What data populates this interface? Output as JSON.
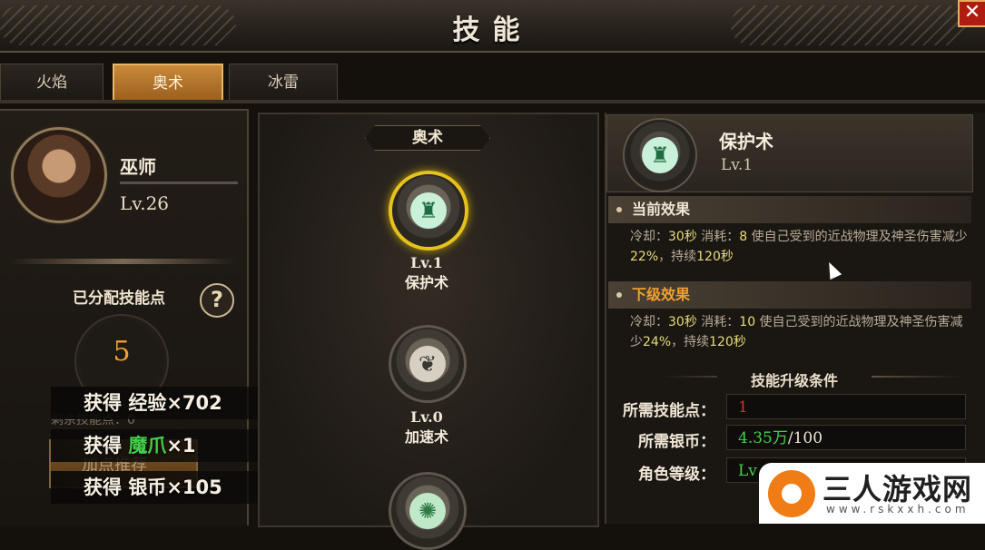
{
  "window": {
    "title": "技能",
    "close_label": "✕"
  },
  "tabs": [
    {
      "label": "火焰",
      "active": false
    },
    {
      "label": "奥术",
      "active": true
    },
    {
      "label": "冰雷",
      "active": false
    }
  ],
  "hero": {
    "name": "巫师",
    "level": "Lv.26"
  },
  "points": {
    "allocated_label": "已分配技能点",
    "help_icon": "?",
    "allocated_value": "5",
    "remaining_label": "剩余技能点：0",
    "recommend_label": "加点推荐"
  },
  "rewards": [
    {
      "prefix": "获得 ",
      "item": "经验",
      "suffix": "×702",
      "highlight": false
    },
    {
      "prefix": "获得 ",
      "item": "魔爪",
      "suffix": "×1",
      "highlight": true
    },
    {
      "prefix": "获得 ",
      "item": "银币",
      "suffix": "×105",
      "highlight": false
    }
  ],
  "school": {
    "label": "奥术"
  },
  "skills": [
    {
      "name": "保护术",
      "level": "Lv.1",
      "icon": "shield-rune-icon",
      "glyph": "♜",
      "selected": true
    },
    {
      "name": "加速术",
      "level": "Lv.0",
      "icon": "wing-boot-icon",
      "glyph": "❦",
      "selected": false
    },
    {
      "name": "",
      "level": "",
      "icon": "orb-icon",
      "glyph": "✺",
      "selected": false
    }
  ],
  "detail": {
    "name": "保护术",
    "level": "Lv.1",
    "icon": "shield-rune-icon",
    "current_title": "当前效果",
    "current": {
      "p1": "冷却：",
      "cd": "30秒",
      "p2": " 消耗：",
      "cost": "8",
      "p3": " 使自己受到的近战物理及神圣伤害减少",
      "pct": "22%",
      "p4": "，持续",
      "dur": "120秒"
    },
    "next_title": "下级效果",
    "next": {
      "p1": "冷却：",
      "cd": "30秒",
      "p2": " 消耗：",
      "cost": "10",
      "p3": " 使自己受到的近战物理及神圣伤害减少",
      "pct": "24%",
      "p4": "，持续",
      "dur": "120秒"
    }
  },
  "conditions": {
    "title": "技能升级条件",
    "rows": [
      {
        "label": "所需技能点：",
        "value": "1",
        "extra": "",
        "color": "#d83030"
      },
      {
        "label": "所需银币：",
        "value": "4.35万",
        "extra": "/100",
        "color": "#44d04a"
      },
      {
        "label": "角色等级：",
        "value": "Lv",
        "extra": "",
        "color": "#44d04a"
      }
    ]
  },
  "watermark": {
    "text": "三人游戏网",
    "url": "www.rskxxh.com"
  },
  "colors": {
    "accent": "#c98a3a",
    "selected_ring": "#e6c21c",
    "positive": "#44d04a",
    "warning": "#d83030",
    "points": "#f0a030"
  }
}
